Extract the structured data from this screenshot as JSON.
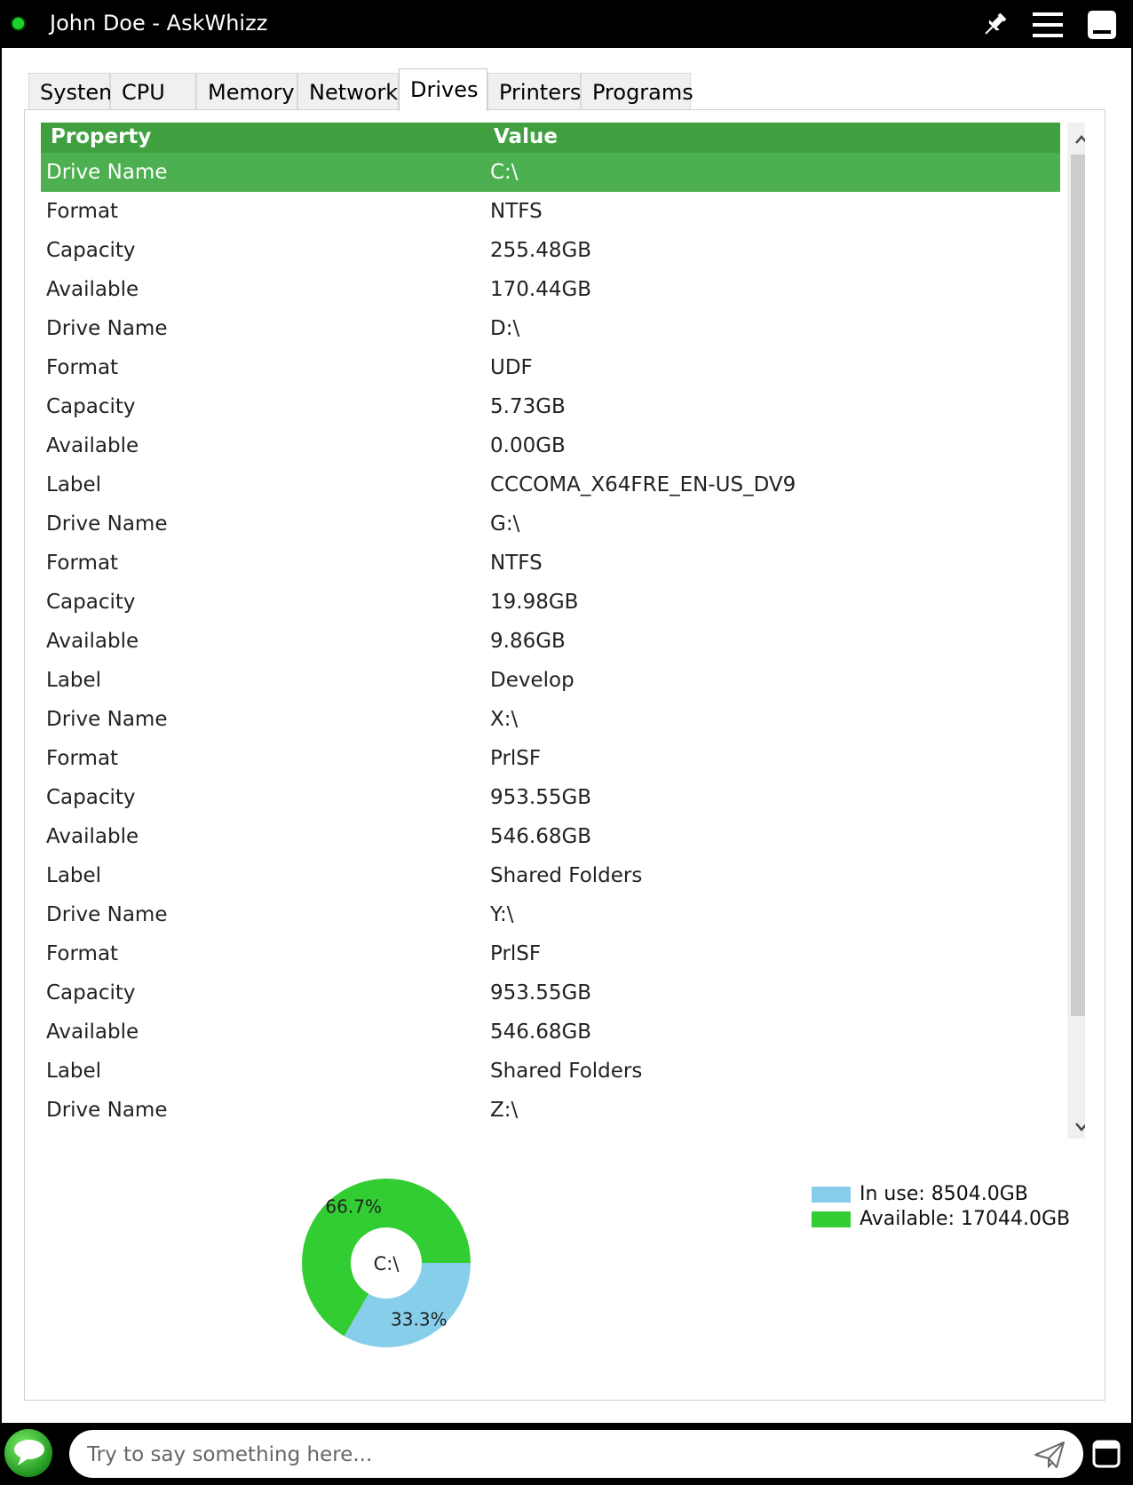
{
  "window": {
    "title": "John Doe - AskWhizz",
    "status_color": "#1bd12b"
  },
  "titlebar_icons": [
    "pin-icon",
    "menu-icon",
    "minimize-icon"
  ],
  "tabs": [
    {
      "label": "System"
    },
    {
      "label": "CPU"
    },
    {
      "label": "Memory"
    },
    {
      "label": "Network"
    },
    {
      "label": "Drives",
      "active": true
    },
    {
      "label": "Printers"
    },
    {
      "label": "Programs"
    }
  ],
  "grid": {
    "header": {
      "property": "Property",
      "value": "Value"
    },
    "header_color": "#40a040",
    "selected_color": "#4caf50",
    "selected_index": 0,
    "rows": [
      {
        "property": "Drive Name",
        "value": "C:\\"
      },
      {
        "property": "Format",
        "value": "NTFS"
      },
      {
        "property": "Capacity",
        "value": "255.48GB"
      },
      {
        "property": "Available",
        "value": "170.44GB"
      },
      {
        "property": "Drive Name",
        "value": "D:\\"
      },
      {
        "property": "Format",
        "value": "UDF"
      },
      {
        "property": "Capacity",
        "value": "5.73GB"
      },
      {
        "property": "Available",
        "value": "0.00GB"
      },
      {
        "property": "Label",
        "value": "CCCOMA_X64FRE_EN-US_DV9"
      },
      {
        "property": "Drive Name",
        "value": "G:\\"
      },
      {
        "property": "Format",
        "value": "NTFS"
      },
      {
        "property": "Capacity",
        "value": "19.98GB"
      },
      {
        "property": "Available",
        "value": "9.86GB"
      },
      {
        "property": "Label",
        "value": "Develop"
      },
      {
        "property": "Drive Name",
        "value": "X:\\"
      },
      {
        "property": "Format",
        "value": "PrlSF"
      },
      {
        "property": "Capacity",
        "value": "953.55GB"
      },
      {
        "property": "Available",
        "value": "546.68GB"
      },
      {
        "property": "Label",
        "value": "Shared Folders"
      },
      {
        "property": "Drive Name",
        "value": "Y:\\"
      },
      {
        "property": "Format",
        "value": "PrlSF"
      },
      {
        "property": "Capacity",
        "value": "953.55GB"
      },
      {
        "property": "Available",
        "value": "546.68GB"
      },
      {
        "property": "Label",
        "value": "Shared Folders"
      },
      {
        "property": "Drive Name",
        "value": "Z:\\"
      }
    ]
  },
  "chart_data": {
    "type": "pie",
    "center_label": "C:\\",
    "slices": [
      {
        "label": "In use: 8504.0GB",
        "value": 33.3,
        "pct_label": "33.3%",
        "color": "#87ceeb"
      },
      {
        "label": "Available: 17044.0GB",
        "value": 66.7,
        "pct_label": "66.7%",
        "color": "#32cd32"
      }
    ],
    "legend_position": "top-right"
  },
  "chat": {
    "placeholder": "Try to say something here..."
  }
}
